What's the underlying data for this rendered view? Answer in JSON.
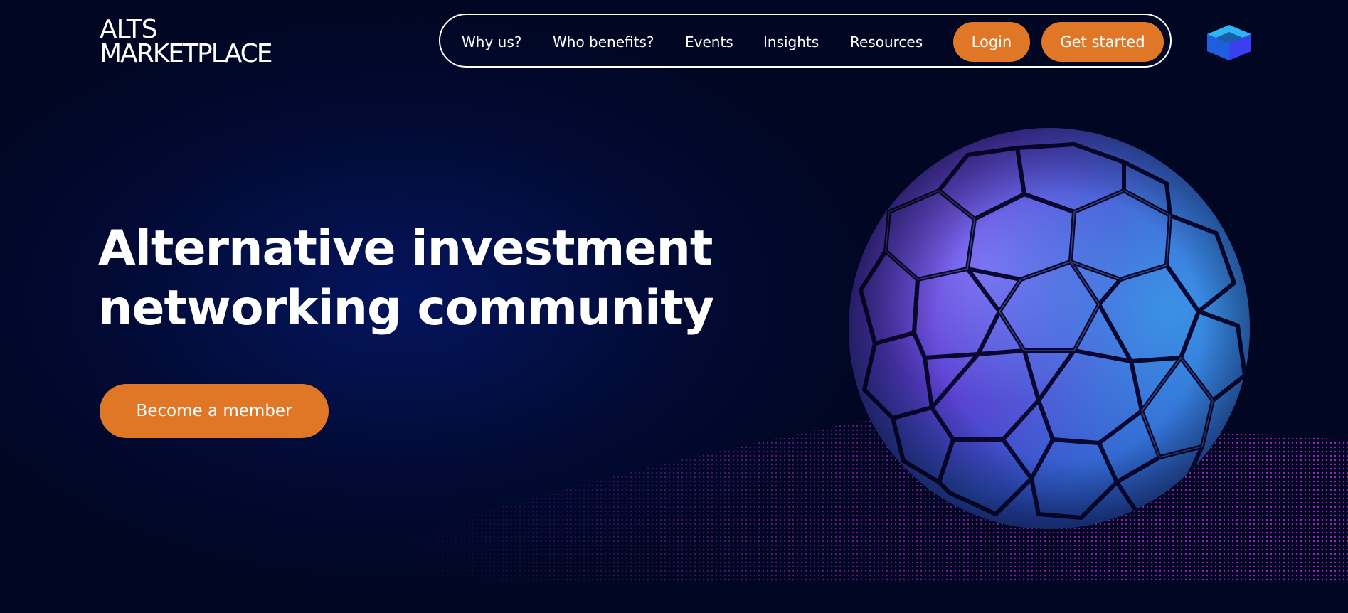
{
  "logo": {
    "line1": "ALTS",
    "line2": "MARKETPLACE"
  },
  "nav": {
    "links": [
      "Why us?",
      "Who benefits?",
      "Events",
      "Insights",
      "Resources"
    ],
    "login_label": "Login",
    "get_started_label": "Get started"
  },
  "hero": {
    "title_line1": "Alternative investment",
    "title_line2": "networking community",
    "cta_label": "Become a member"
  },
  "colors": {
    "accent": "#e07727",
    "background": "#020a33",
    "text": "#ffffff",
    "sphere_purple": "#6a4fe0",
    "sphere_blue": "#2f7fd8",
    "wave_magenta": "#c02ad8"
  },
  "icons": {
    "brand_mark": "cube-icon",
    "hero_visual": "geodesic-sphere-icon"
  }
}
